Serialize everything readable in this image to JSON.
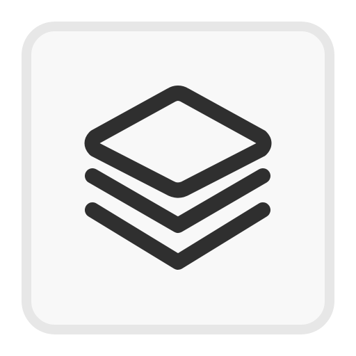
{
  "app_icon": {
    "icon": "layers-icon",
    "colors": {
      "stroke": "#2f2f2f",
      "tile_background": "#f8f8f8",
      "tile_border": "#e7e7e7",
      "page_background": "#ffffff"
    }
  }
}
